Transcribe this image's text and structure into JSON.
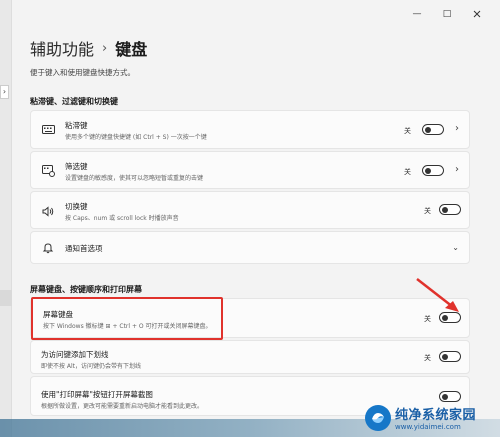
{
  "window": {
    "minimize": "—",
    "maximize": "□"
  },
  "breadcrumb": {
    "parent": "辅助功能",
    "separator": "›",
    "current": "键盘"
  },
  "page_desc": "便于键入和使用键盘快捷方式。",
  "section1": {
    "title": "粘滞键、过滤键和切换键"
  },
  "sticky": {
    "title": "粘滞键",
    "desc": "使用多个键的键盘快捷键 (如 Ctrl + S) 一次按一个键",
    "state": "关"
  },
  "filter": {
    "title": "筛选键",
    "desc": "设置键盘的敏感度，使其可以忽略短暂或重复的击键",
    "state": "关"
  },
  "toggle_keys": {
    "title": "切换键",
    "desc": "按 Caps、num 或 scroll lock 时播放声音",
    "state": "关"
  },
  "notify": {
    "title": "通知首选项"
  },
  "section2": {
    "title": "屏幕键盘、按键顺序和打印屏幕"
  },
  "osk": {
    "title": "屏幕键盘",
    "desc": "按下 Windows 徽标键 ⊞ + Ctrl + O 可打开或关闭屏幕键盘。",
    "state": "关"
  },
  "underline": {
    "title": "为访问键添加下划线",
    "desc": "即使不按 Alt，访问键仍会带有下划线",
    "state": "关"
  },
  "printscreen": {
    "title": "使用\"打印屏幕\"按钮打开屏幕截图",
    "desc": "根据所做设置，更改可能需要重新启动电脑才能看到此更改。"
  },
  "watermark": {
    "title": "纯净系统家园",
    "url": "www.yidaimei.com"
  },
  "colors": {
    "highlight": "#e0322c",
    "accent": "#1a5fa6"
  }
}
